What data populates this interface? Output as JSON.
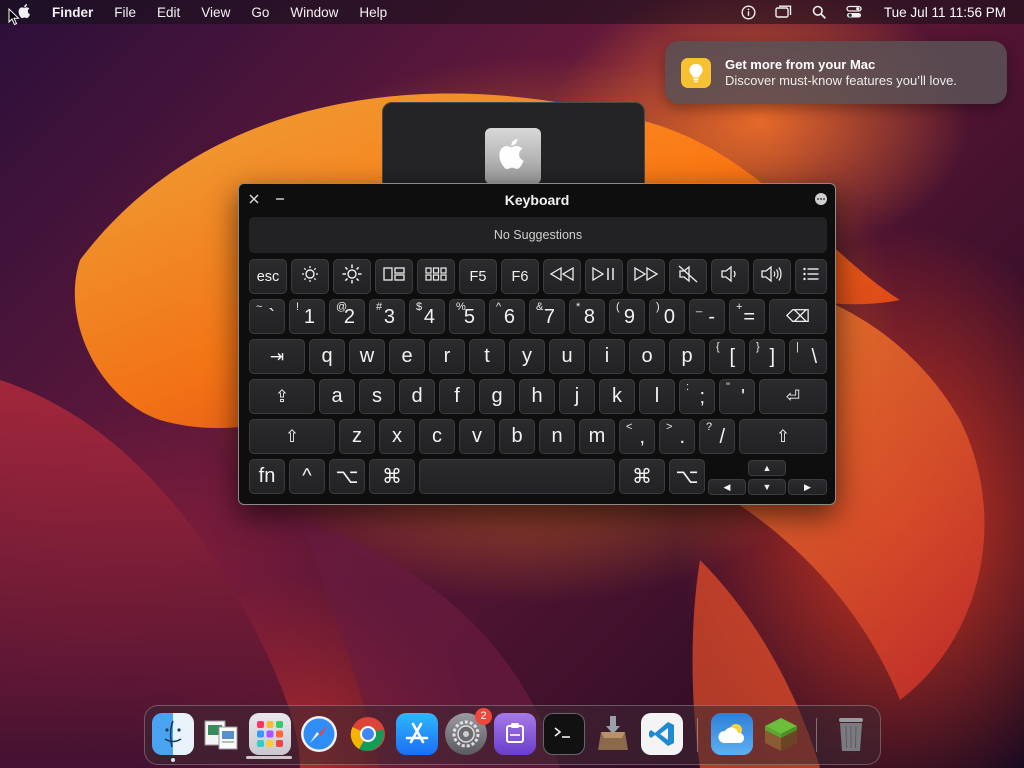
{
  "menubar": {
    "app_name": "Finder",
    "menus": [
      "File",
      "Edit",
      "View",
      "Go",
      "Window",
      "Help"
    ],
    "clock": "Tue Jul 11  11:56 PM",
    "status_icons": [
      "info-icon",
      "display-icon",
      "search-icon",
      "control-center-icon"
    ]
  },
  "notification": {
    "title": "Get more from your Mac",
    "subtitle": "Discover must-know features you’ll love.",
    "icon": "lightbulb-icon"
  },
  "keyboard_viewer": {
    "title": "Keyboard",
    "suggestions": "No Suggestions",
    "function_row": {
      "esc": "esc",
      "f5": "F5",
      "f6": "F6",
      "icons": [
        "brightness-down-icon",
        "brightness-up-icon",
        "mission-control-icon",
        "launchpad-icon",
        "rewind-icon",
        "play-pause-icon",
        "fast-forward-icon",
        "mute-icon",
        "volume-down-icon",
        "volume-up-icon",
        "list-icon"
      ]
    },
    "number_row": [
      {
        "shift": "~",
        "main": "`"
      },
      {
        "shift": "!",
        "main": "1"
      },
      {
        "shift": "@",
        "main": "2"
      },
      {
        "shift": "#",
        "main": "3"
      },
      {
        "shift": "$",
        "main": "4"
      },
      {
        "shift": "%",
        "main": "5"
      },
      {
        "shift": "^",
        "main": "6"
      },
      {
        "shift": "&",
        "main": "7"
      },
      {
        "shift": "*",
        "main": "8"
      },
      {
        "shift": "(",
        "main": "9"
      },
      {
        "shift": ")",
        "main": "0"
      },
      {
        "shift": "_",
        "main": "-"
      },
      {
        "shift": "+",
        "main": "="
      }
    ],
    "qwerty_row": [
      "q",
      "w",
      "e",
      "r",
      "t",
      "y",
      "u",
      "i",
      "o",
      "p"
    ],
    "qwerty_row_symbols": [
      {
        "shift": "{",
        "main": "["
      },
      {
        "shift": "}",
        "main": "]"
      },
      {
        "shift": "|",
        "main": "\\"
      }
    ],
    "home_row": [
      "a",
      "s",
      "d",
      "f",
      "g",
      "h",
      "j",
      "k",
      "l"
    ],
    "home_row_symbols": [
      {
        "shift": ":",
        "main": ";"
      },
      {
        "shift": "\"",
        "main": "'"
      }
    ],
    "bottom_row": [
      "z",
      "x",
      "c",
      "v",
      "b",
      "n",
      "m"
    ],
    "bottom_row_symbols": [
      {
        "shift": "<",
        "main": ","
      },
      {
        "shift": ">",
        "main": "."
      },
      {
        "shift": "?",
        "main": "/"
      }
    ],
    "modifiers": {
      "fn": "fn",
      "control": "^",
      "option_left": "⌥",
      "command_left": "⌘",
      "command_right": "⌘",
      "option_right": "⌥",
      "tab": "⇥",
      "return": "⏎",
      "delete": "⌫",
      "caps_lock": "⇪",
      "shift": "⇧"
    },
    "arrows": {
      "up": "▲",
      "left": "◀",
      "down": "▼",
      "right": "▶"
    }
  },
  "dock": {
    "apps": [
      "Finder",
      "Preview",
      "Launchpad",
      "Safari",
      "Google Chrome",
      "App Store",
      "System Settings",
      "Clipboard",
      "Terminal",
      "Installer",
      "Visual Studio Code",
      "Weather",
      "Minecraft",
      "Trash"
    ],
    "system_settings_badge": "2"
  },
  "colors": {
    "accent_badge": "#f0463c",
    "notification_icon": "#f6c234",
    "key_fill": "#2b2b2d"
  }
}
